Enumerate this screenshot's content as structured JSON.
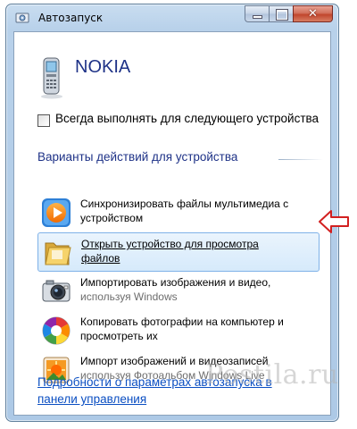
{
  "window": {
    "title": "Автозапуск",
    "device_name": "NOKIA",
    "always_label": "Всегда выполнять для следующего устройства"
  },
  "section": {
    "header": "Варианты действий для устройства"
  },
  "options": [
    {
      "line1": "Синхронизировать файлы мультимедиа с",
      "line2": "устройством",
      "icon": "media-player-icon",
      "selected": false
    },
    {
      "line1": "Открыть устройство для просмотра",
      "line2": "файлов",
      "icon": "folder-icon",
      "selected": true
    },
    {
      "line1": "Импортировать изображения и видео,",
      "line2": "используя Windows",
      "icon": "camera-icon",
      "selected": false
    },
    {
      "line1": "Копировать фотографии на компьютер и",
      "line2": "просмотреть их",
      "icon": "picasa-icon",
      "selected": false
    },
    {
      "line1": "Импорт изображений и видеозаписей",
      "line2": "используя Фотоальбом Windows Live",
      "icon": "photo-gallery-icon",
      "selected": false
    }
  ],
  "footer": {
    "line1": "Подробности о параметрах автозапуска в",
    "line2": "панели управления"
  },
  "watermark": {
    "text": "Postila.ru"
  },
  "colors": {
    "link": "#0a4ec2",
    "header": "#1e3287",
    "selection": "#d6eafb",
    "arrow": "#d22020"
  }
}
